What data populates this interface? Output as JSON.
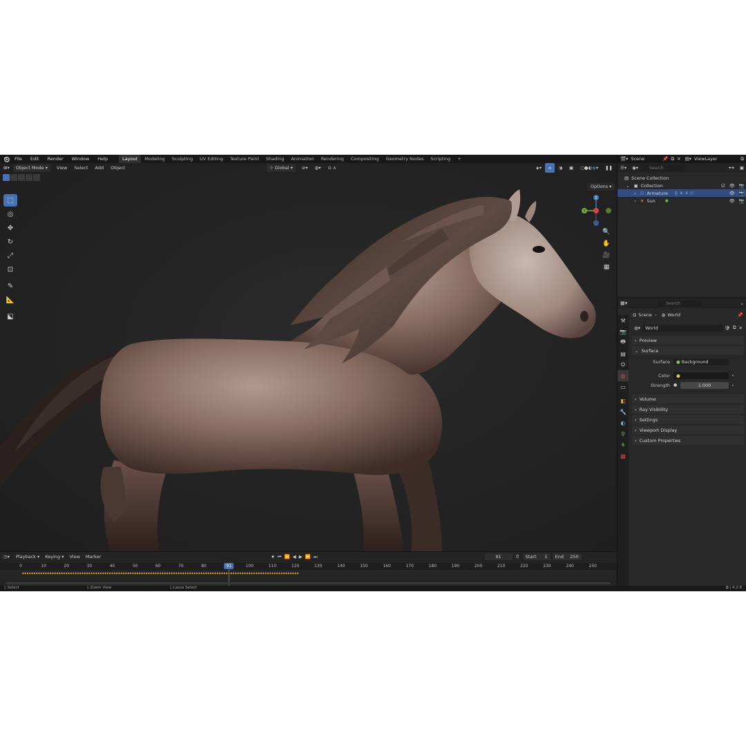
{
  "menu": [
    "File",
    "Edit",
    "Render",
    "Window",
    "Help"
  ],
  "workspaces": [
    {
      "label": "Layout",
      "active": true
    },
    {
      "label": "Modeling"
    },
    {
      "label": "Sculpting"
    },
    {
      "label": "UV Editing"
    },
    {
      "label": "Texture Paint"
    },
    {
      "label": "Shading"
    },
    {
      "label": "Animation"
    },
    {
      "label": "Rendering"
    },
    {
      "label": "Compositing"
    },
    {
      "label": "Geometry Nodes"
    },
    {
      "label": "Scripting"
    }
  ],
  "add_workspace": "+",
  "scene_bar": {
    "scene": "Scene",
    "view_layer": "ViewLayer"
  },
  "viewport": {
    "mode": "Object Mode",
    "menus": [
      "View",
      "Select",
      "Add",
      "Object"
    ],
    "orientation": "Global",
    "options": "Options",
    "gizmo_axes": {
      "z": "Z",
      "y": "Y"
    }
  },
  "outliner": {
    "search_placeholder": "Search",
    "scene_collection": "Scene Collection",
    "collection": "Collection",
    "items": [
      {
        "label": "Armature",
        "selected": true
      },
      {
        "label": "Sun"
      }
    ]
  },
  "properties": {
    "search_placeholder": "Search",
    "breadcrumb": [
      "Scene",
      "World"
    ],
    "world_name": "World",
    "panels": {
      "preview": "Preview",
      "surface": "Surface",
      "volume": "Volume",
      "ray_visibility": "Ray Visibility",
      "settings": "Settings",
      "viewport_display": "Viewport Display",
      "custom_properties": "Custom Properties"
    },
    "surface_label": "Surface",
    "surface_value": "Background",
    "color_label": "Color",
    "strength_label": "Strength",
    "strength_value": "1.000"
  },
  "timeline": {
    "menus": [
      "Playback",
      "Keying",
      "View",
      "Marker"
    ],
    "current_frame": "91",
    "start_label": "Start",
    "start_value": "1",
    "end_label": "End",
    "end_value": "250",
    "ruler_labels": [
      "0",
      "10",
      "20",
      "30",
      "40",
      "50",
      "60",
      "70",
      "80",
      "91",
      "100",
      "110",
      "120",
      "130",
      "140",
      "150",
      "160",
      "170",
      "180",
      "190",
      "200",
      "210",
      "220",
      "230",
      "240",
      "250"
    ],
    "ruler_frames": [
      0,
      10,
      20,
      30,
      40,
      50,
      60,
      70,
      80,
      91,
      100,
      110,
      120,
      130,
      140,
      150,
      160,
      170,
      180,
      190,
      200,
      210,
      220,
      230,
      240,
      250
    ],
    "keyframe_end": 121
  },
  "statusbar": {
    "select": "Select",
    "zoom": "Zoom View",
    "lasso": "Lasso Select",
    "version": "4.2.8"
  },
  "colors": {
    "accent": "#4772b3",
    "keyframe": "#e8a33c",
    "background": "#1d1d1d"
  }
}
